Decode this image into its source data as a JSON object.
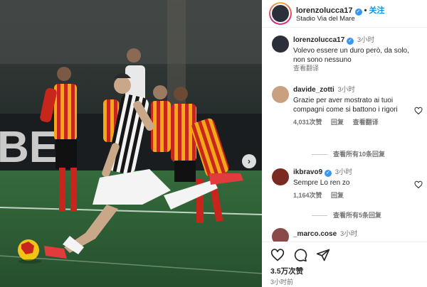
{
  "header": {
    "username": "lorenzolucca17",
    "follow_label": "关注",
    "location": "Stadio Via del Mare"
  },
  "caption": {
    "username": "lorenzolucca17",
    "time": "3小时",
    "text": "Volevo essere un duro però, da solo, non sono nessuno",
    "see_translation": "查看翻译"
  },
  "comments": [
    {
      "username": "davide_zotti",
      "time": "3小时",
      "text": "Grazie per aver mostrato ai tuoi compagni come si battono i rigori",
      "likes": "4,031次赞",
      "reply_label": "回复",
      "translate_label": "查看翻译",
      "replies_label": "查看所有10条回复"
    },
    {
      "username": "ikbravo9",
      "time": "3小时",
      "text": "Sempre Lo ren zo",
      "likes": "1,164次赞",
      "reply_label": "回复",
      "replies_label": "查看所有5条回复"
    },
    {
      "username": "_marco.cose",
      "time": "3小时"
    }
  ],
  "footer": {
    "likes": "3.5万次赞",
    "time_ago": "3小时前"
  },
  "colors": {
    "accent": "#0095f6",
    "verified": "#3897f0",
    "home_kit_red": "#c8261c",
    "home_kit_yellow": "#f2c418"
  },
  "icons": {
    "like": "heart-icon",
    "comment": "comment-icon",
    "share": "share-icon",
    "next": "chevron-right-icon"
  }
}
